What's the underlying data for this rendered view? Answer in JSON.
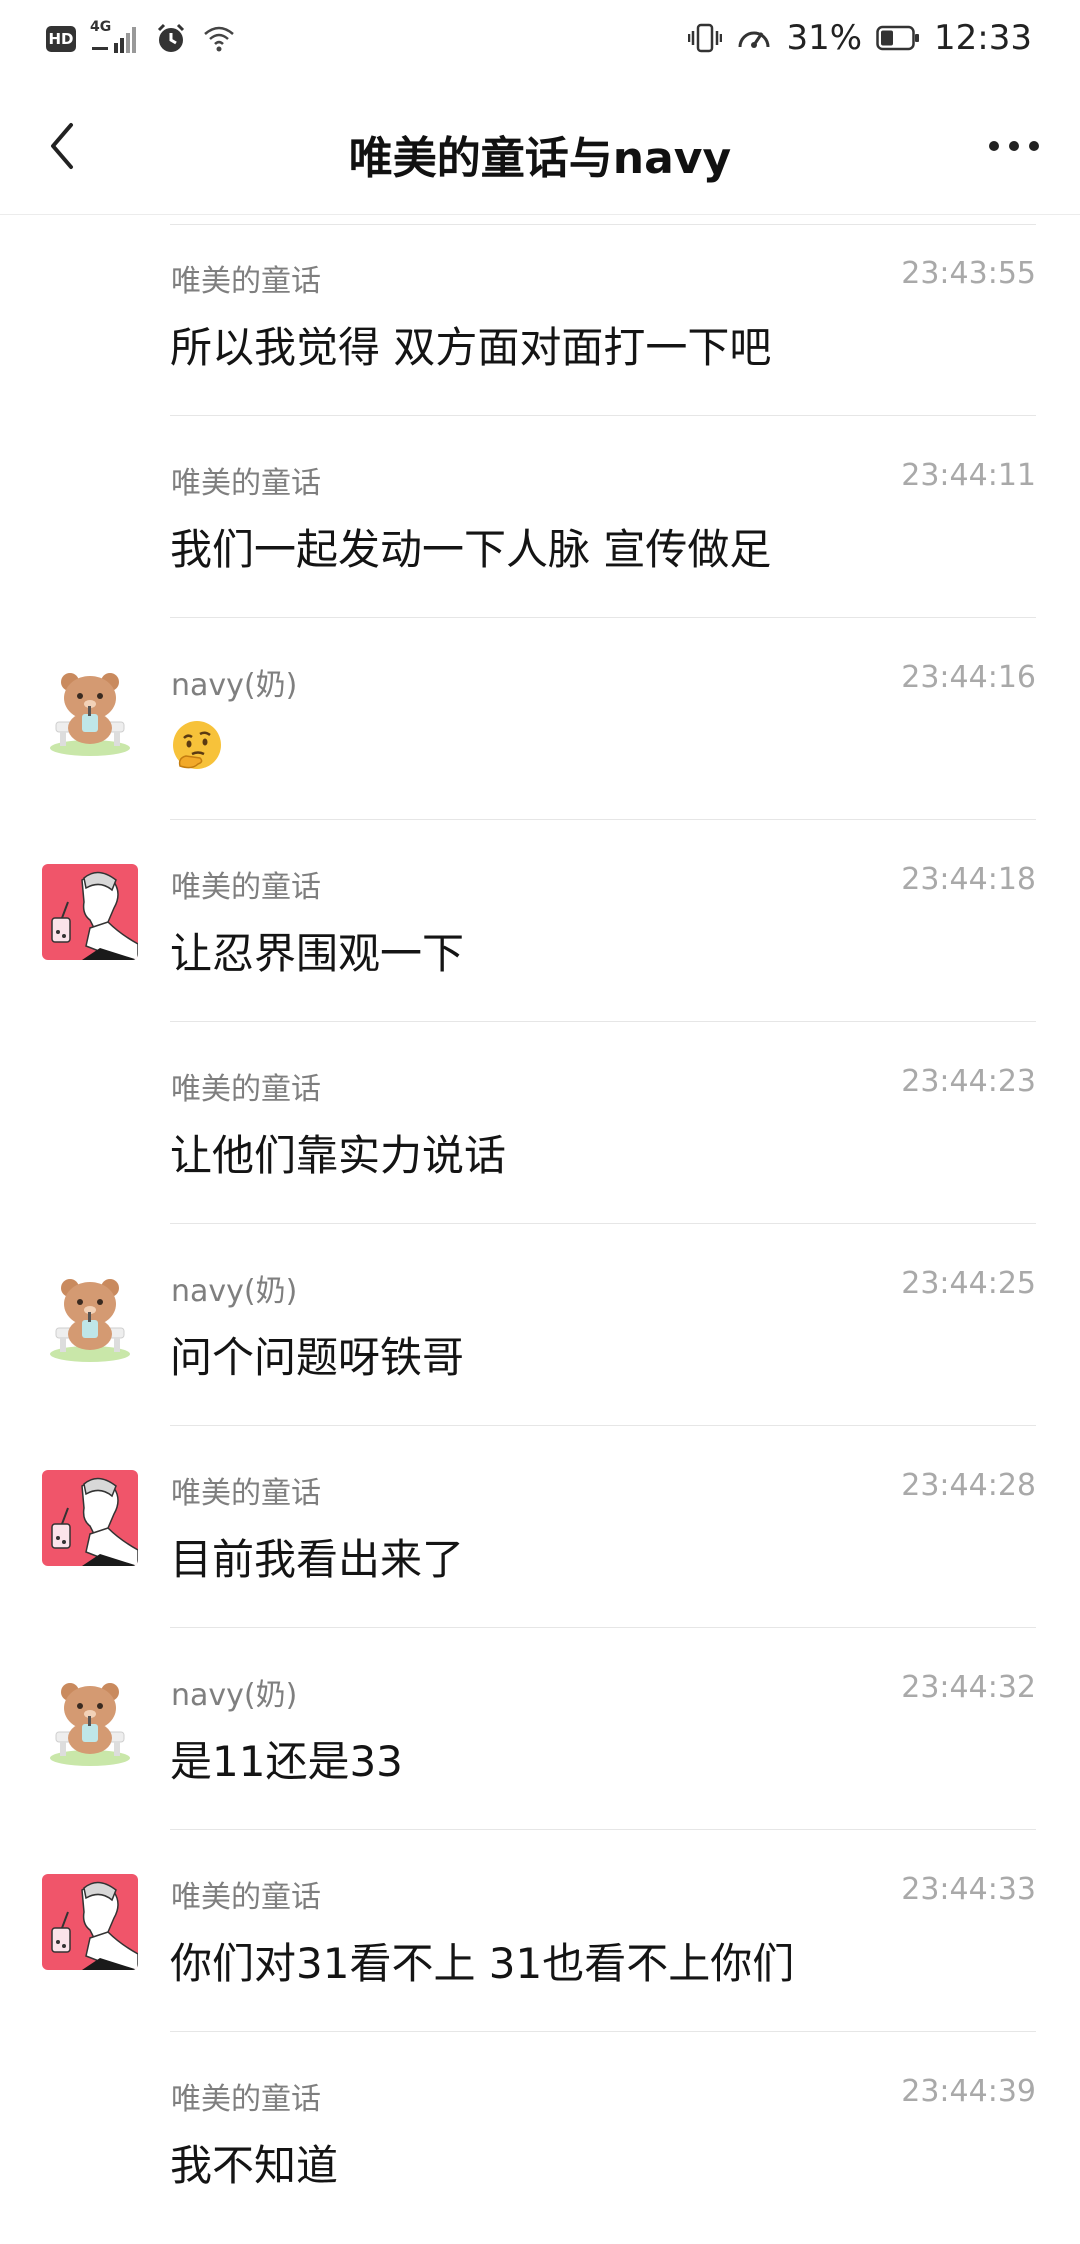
{
  "status_bar": {
    "hd": "HD",
    "network": "4G",
    "battery": "31%",
    "time": "12:33"
  },
  "header": {
    "title": "唯美的童话与navy"
  },
  "messages": [
    {
      "sender": "唯美的童话",
      "time": "23:43:55",
      "text": "所以我觉得 双方面对面打一下吧",
      "avatar": "none"
    },
    {
      "sender": "唯美的童话",
      "time": "23:44:11",
      "text": "我们一起发动一下人脉 宣传做足",
      "avatar": "none"
    },
    {
      "sender": "navy(奶)",
      "time": "23:44:16",
      "text": "",
      "avatar": "bear",
      "emoji": "thinking-face"
    },
    {
      "sender": "唯美的童话",
      "time": "23:44:18",
      "text": "让忍界围观一下",
      "avatar": "man"
    },
    {
      "sender": "唯美的童话",
      "time": "23:44:23",
      "text": "让他们靠实力说话",
      "avatar": "none"
    },
    {
      "sender": "navy(奶)",
      "time": "23:44:25",
      "text": "问个问题呀铁哥",
      "avatar": "bear"
    },
    {
      "sender": "唯美的童话",
      "time": "23:44:28",
      "text": "目前我看出来了",
      "avatar": "man"
    },
    {
      "sender": "navy(奶)",
      "time": "23:44:32",
      "text": "是11还是33",
      "avatar": "bear"
    },
    {
      "sender": "唯美的童话",
      "time": "23:44:33",
      "text": "你们对31看不上 31也看不上你们",
      "avatar": "man"
    },
    {
      "sender": "唯美的童话",
      "time": "23:44:39",
      "text": "我不知道",
      "avatar": "none"
    }
  ],
  "colors": {
    "man_avatar_bg": "#f0556a",
    "bear_fur": "#d49a72",
    "divider": "#e6e6e6"
  }
}
